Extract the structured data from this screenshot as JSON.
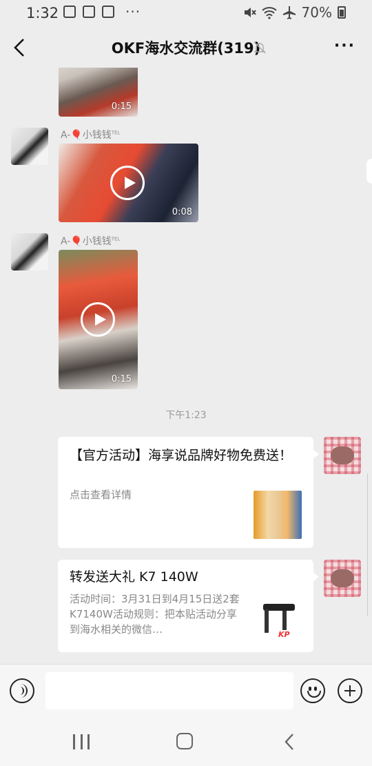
{
  "status_bar": {
    "time": "1:32",
    "battery": "70%",
    "icons": [
      "image-icon",
      "app-icon",
      "tiktok-icon",
      "more-dots-icon",
      "mute-icon",
      "wifi-icon",
      "airplane-icon",
      "battery-icon"
    ],
    "dots": "···"
  },
  "header": {
    "title": "OKF海水交流群(319)",
    "icons": [
      "back-icon",
      "mute-bell-icon",
      "more-icon"
    ],
    "more": "···"
  },
  "messages": [
    {
      "type": "video",
      "duration": "0:15"
    },
    {
      "type": "video",
      "sender": "A-🎈小钱钱",
      "sender_badge": "TEL",
      "duration": "0:08"
    },
    {
      "type": "video",
      "sender": "A-🎈小钱钱",
      "sender_badge": "TEL",
      "duration": "0:15"
    },
    {
      "type": "timestamp",
      "text": "下午1:23"
    },
    {
      "type": "card",
      "title": "【官方活动】海享说品牌好物免费送！",
      "description": "点击查看详情"
    },
    {
      "type": "card",
      "title": "转发送大礼 K7 140W",
      "description": "活动时间：3月31日到4月15日送2套K7140W活动规则：把本贴活动分享到海水相关的微信…",
      "thumb_brand": "KP"
    }
  ],
  "input_bar": {
    "icons": [
      "voice-icon",
      "emoji-icon",
      "plus-icon"
    ],
    "placeholder": ""
  },
  "nav_bar": {
    "icons": [
      "recents-icon",
      "home-icon",
      "back-icon"
    ]
  },
  "colors": {
    "background": "#ededed",
    "bubble": "#ffffff",
    "text_secondary": "#888888"
  }
}
